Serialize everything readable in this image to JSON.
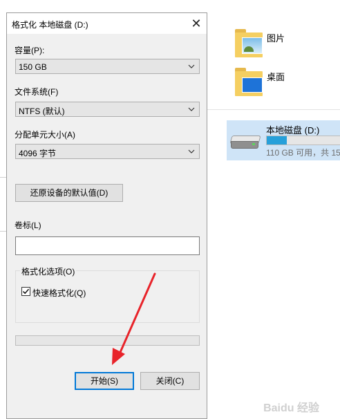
{
  "explorer": {
    "folders": [
      {
        "label": "图片",
        "icon": "pictures-folder-icon"
      },
      {
        "label": "桌面",
        "icon": "desktop-folder-icon"
      }
    ],
    "drive": {
      "name": "本地磁盘 (D:)",
      "free_text": "110 GB 可用，共 15",
      "used_fraction": 0.27,
      "bar_color": "#26a0da"
    }
  },
  "dialog": {
    "title": "格式化 本地磁盘 (D:)",
    "close_glyph": "✕",
    "capacity": {
      "label": "容量(P):",
      "value": "150 GB"
    },
    "filesystem": {
      "label": "文件系统(F)",
      "value": "NTFS (默认)"
    },
    "allocation": {
      "label": "分配单元大小(A)",
      "value": "4096 字节"
    },
    "restore_defaults_label": "还原设备的默认值(D)",
    "volume_label": {
      "label": "卷标(L)",
      "value": ""
    },
    "format_options": {
      "title": "格式化选项(O)",
      "quick_format": {
        "label": "快速格式化(Q)",
        "checked": true
      }
    },
    "progress_fraction": 0,
    "start_label": "开始(S)",
    "close_label": "关闭(C)"
  },
  "annotation": {
    "arrow_color": "#e8232a"
  },
  "watermark": "Baidu 经验",
  "colors": {
    "dialog_bg": "#f0f0f0",
    "accent": "#0078d7",
    "drive_tile": "#cfe4f7"
  }
}
